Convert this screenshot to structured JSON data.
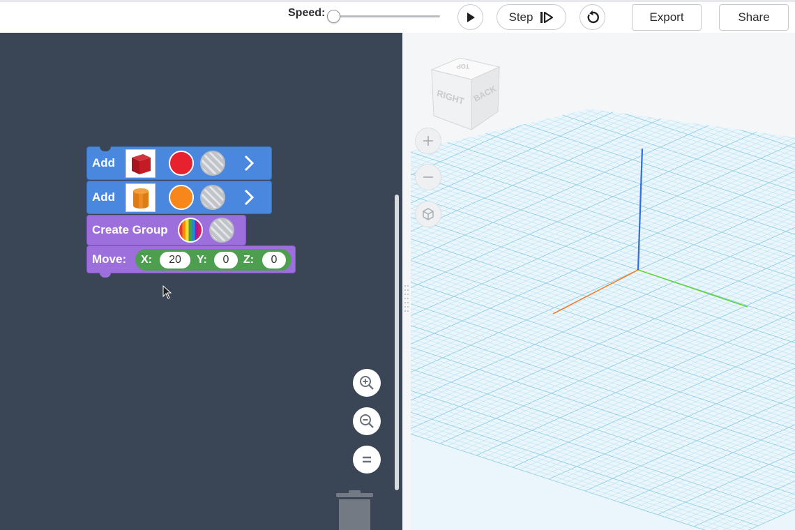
{
  "toolbar": {
    "speed_label": "Speed:",
    "speed_value": 0,
    "step_label": "Step",
    "export_label": "Export",
    "share_label": "Share"
  },
  "blocks": {
    "add1": {
      "label": "Add",
      "shape": "red-cube",
      "color": "#e8212e"
    },
    "add2": {
      "label": "Add",
      "shape": "orange-cylinder",
      "color": "#f7861b"
    },
    "group": {
      "label": "Create Group"
    },
    "move": {
      "label": "Move:",
      "x_label": "X:",
      "x": "20",
      "y_label": "Y:",
      "y": "0",
      "z_label": "Z:",
      "z": "0"
    }
  },
  "viewcube": {
    "face_right": "RIGHT",
    "face_back": "BACK",
    "face_top": "TOP"
  },
  "colors": {
    "workspace": "#3a4555",
    "block_blue": "#4a88e0",
    "block_purple": "#9c6fdc",
    "block_green": "#4d9e4f",
    "axis_x": "#f07f2c",
    "axis_y": "#5fd43a",
    "axis_z": "#2f6fe0",
    "grid": "#8ccde6"
  }
}
